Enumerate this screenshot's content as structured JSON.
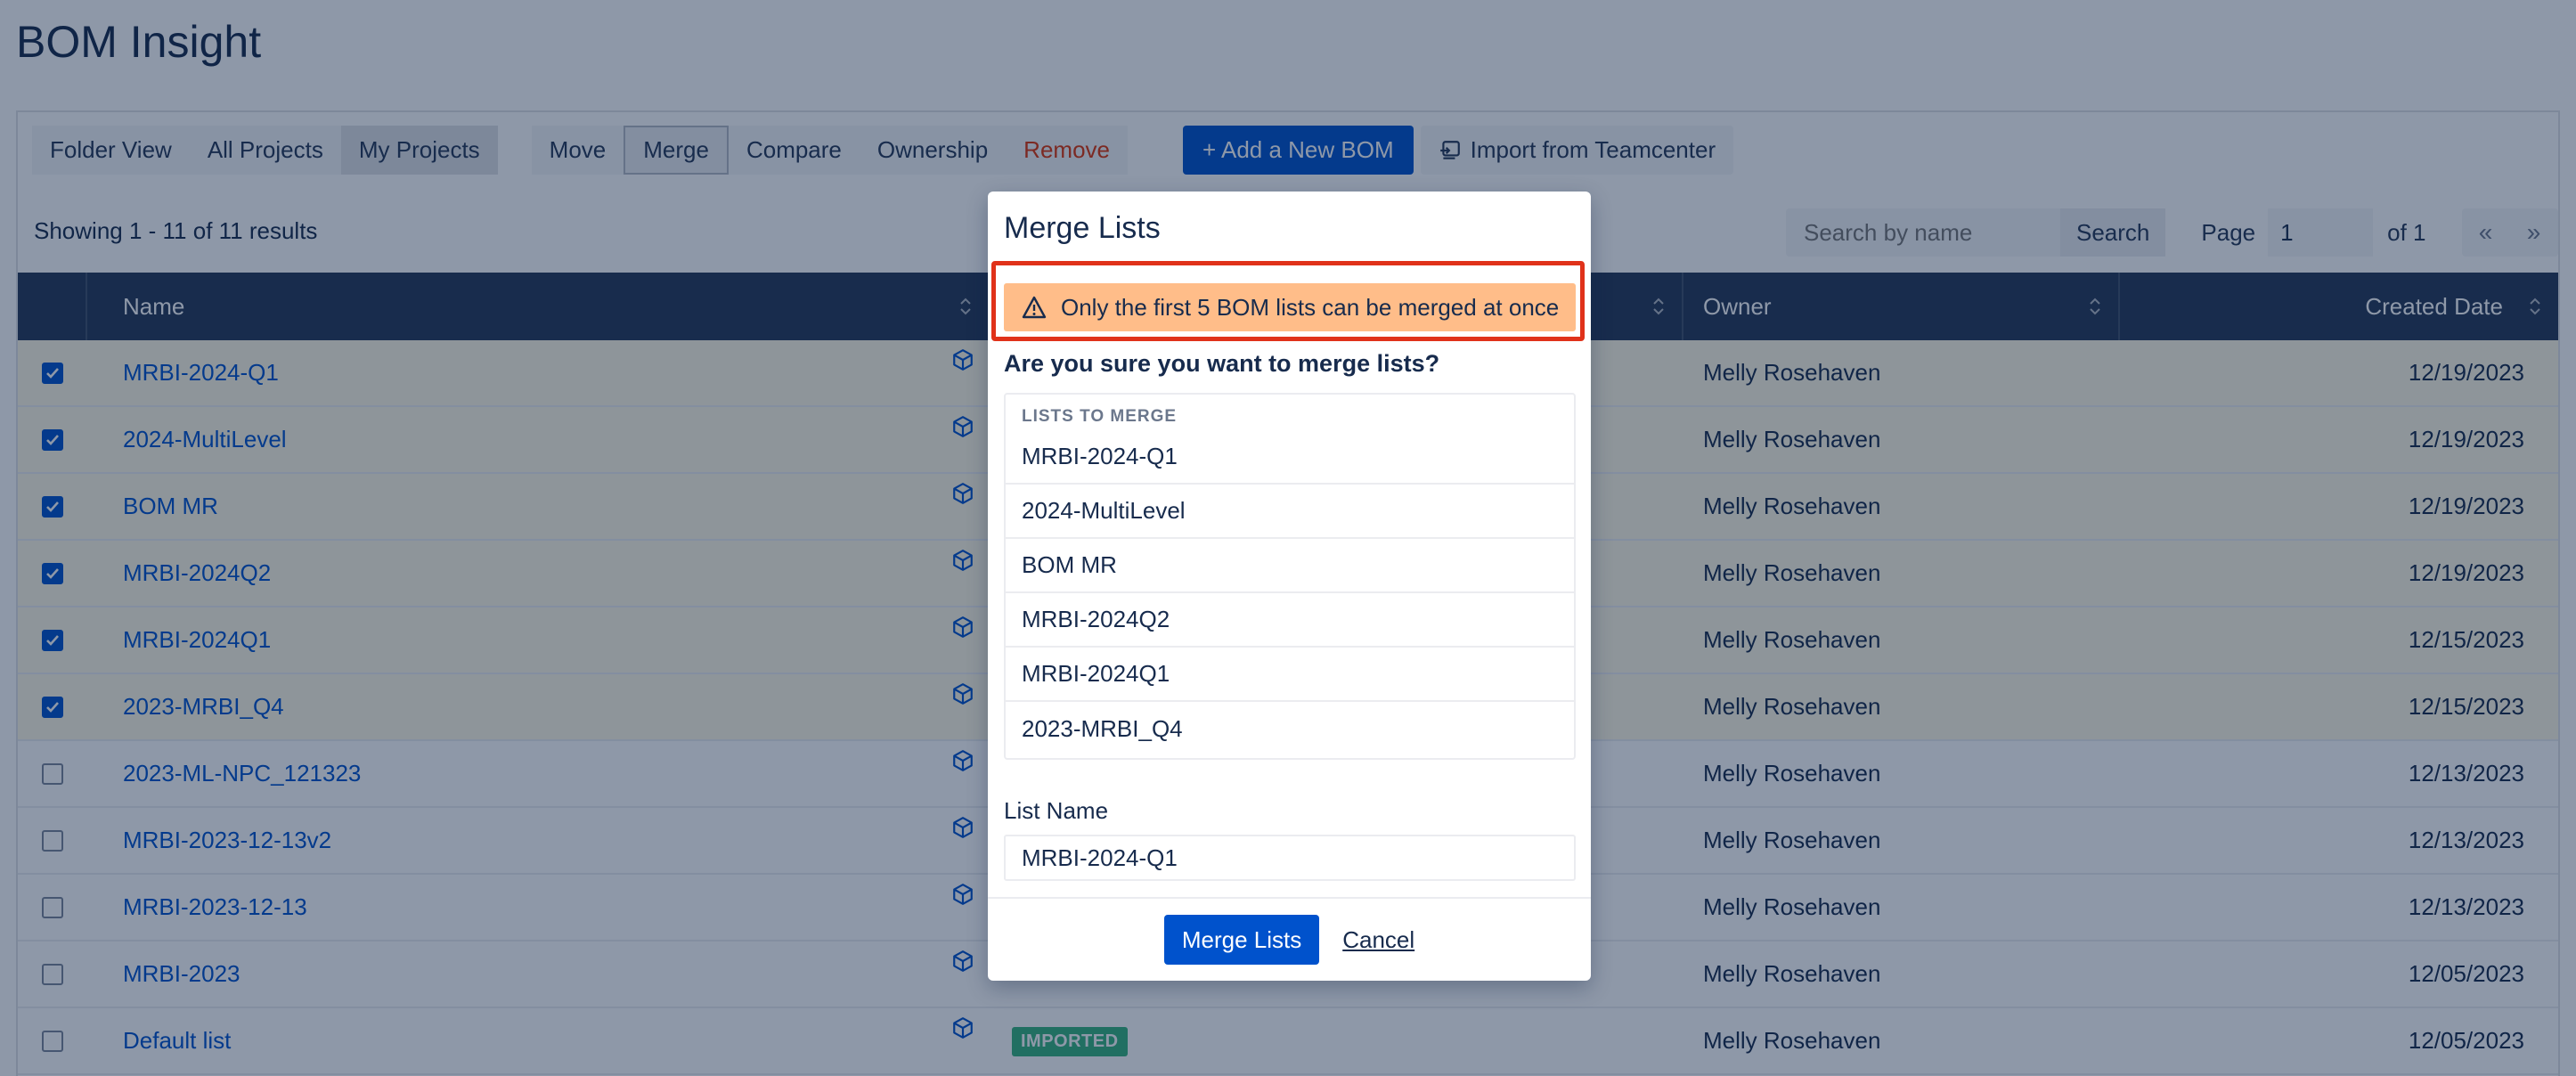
{
  "app": {
    "title": "BOM Insight"
  },
  "toolbar": {
    "view_buttons": [
      "Folder View",
      "All Projects",
      "My Projects"
    ],
    "active_view": "My Projects",
    "action_buttons": [
      "Move",
      "Merge",
      "Compare",
      "Ownership",
      "Remove"
    ],
    "add_button": "+ Add a New BOM",
    "import_button": "Import from Teamcenter"
  },
  "results": {
    "summary": "Showing 1 - 11 of 11 results",
    "search_placeholder": "Search by name",
    "search_button": "Search",
    "page_label": "Page",
    "page_value": "1",
    "of_label": "of 1",
    "prev": "«",
    "next": "»"
  },
  "table": {
    "columns": {
      "name": "Name",
      "owner": "Owner",
      "created": "Created Date"
    },
    "rows": [
      {
        "name": "MRBI-2024-Q1",
        "checked": true,
        "badge": "",
        "owner": "Melly Rosehaven",
        "date": "12/19/2023"
      },
      {
        "name": "2024-MultiLevel",
        "checked": true,
        "badge": "",
        "owner": "Melly Rosehaven",
        "date": "12/19/2023"
      },
      {
        "name": "BOM MR",
        "checked": true,
        "badge": "",
        "owner": "Melly Rosehaven",
        "date": "12/19/2023"
      },
      {
        "name": "MRBI-2024Q2",
        "checked": true,
        "badge": "",
        "owner": "Melly Rosehaven",
        "date": "12/19/2023"
      },
      {
        "name": "MRBI-2024Q1",
        "checked": true,
        "badge": "",
        "owner": "Melly Rosehaven",
        "date": "12/15/2023"
      },
      {
        "name": "2023-MRBI_Q4",
        "checked": true,
        "badge": "",
        "owner": "Melly Rosehaven",
        "date": "12/15/2023"
      },
      {
        "name": "2023-ML-NPC_121323",
        "checked": false,
        "badge": "",
        "owner": "Melly Rosehaven",
        "date": "12/13/2023"
      },
      {
        "name": "MRBI-2023-12-13v2",
        "checked": false,
        "badge": "",
        "owner": "Melly Rosehaven",
        "date": "12/13/2023"
      },
      {
        "name": "MRBI-2023-12-13",
        "checked": false,
        "badge": "",
        "owner": "Melly Rosehaven",
        "date": "12/13/2023"
      },
      {
        "name": "MRBI-2023",
        "checked": false,
        "badge": "",
        "owner": "Melly Rosehaven",
        "date": "12/05/2023"
      },
      {
        "name": "Default list",
        "checked": false,
        "badge": "IMPORTED",
        "owner": "Melly Rosehaven",
        "date": "12/05/2023"
      }
    ]
  },
  "modal": {
    "title": "Merge Lists",
    "warning": "Only the first 5 BOM lists can be merged at once",
    "confirm": "Are you sure you want to merge lists?",
    "list_header": "LISTS TO MERGE",
    "lists": [
      "MRBI-2024-Q1",
      "2024-MultiLevel",
      "BOM MR",
      "MRBI-2024Q2",
      "MRBI-2024Q1",
      "2023-MRBI_Q4"
    ],
    "field_label": "List Name",
    "field_value": "MRBI-2024-Q1",
    "merge_button": "Merge Lists",
    "cancel_button": "Cancel"
  },
  "colors": {
    "primary": "#0052cc",
    "header_bg": "#253858",
    "warning_bg": "#ffbd89",
    "highlight_border": "#e0321a",
    "danger_text": "#de350b",
    "badge_green": "#36b37e"
  }
}
